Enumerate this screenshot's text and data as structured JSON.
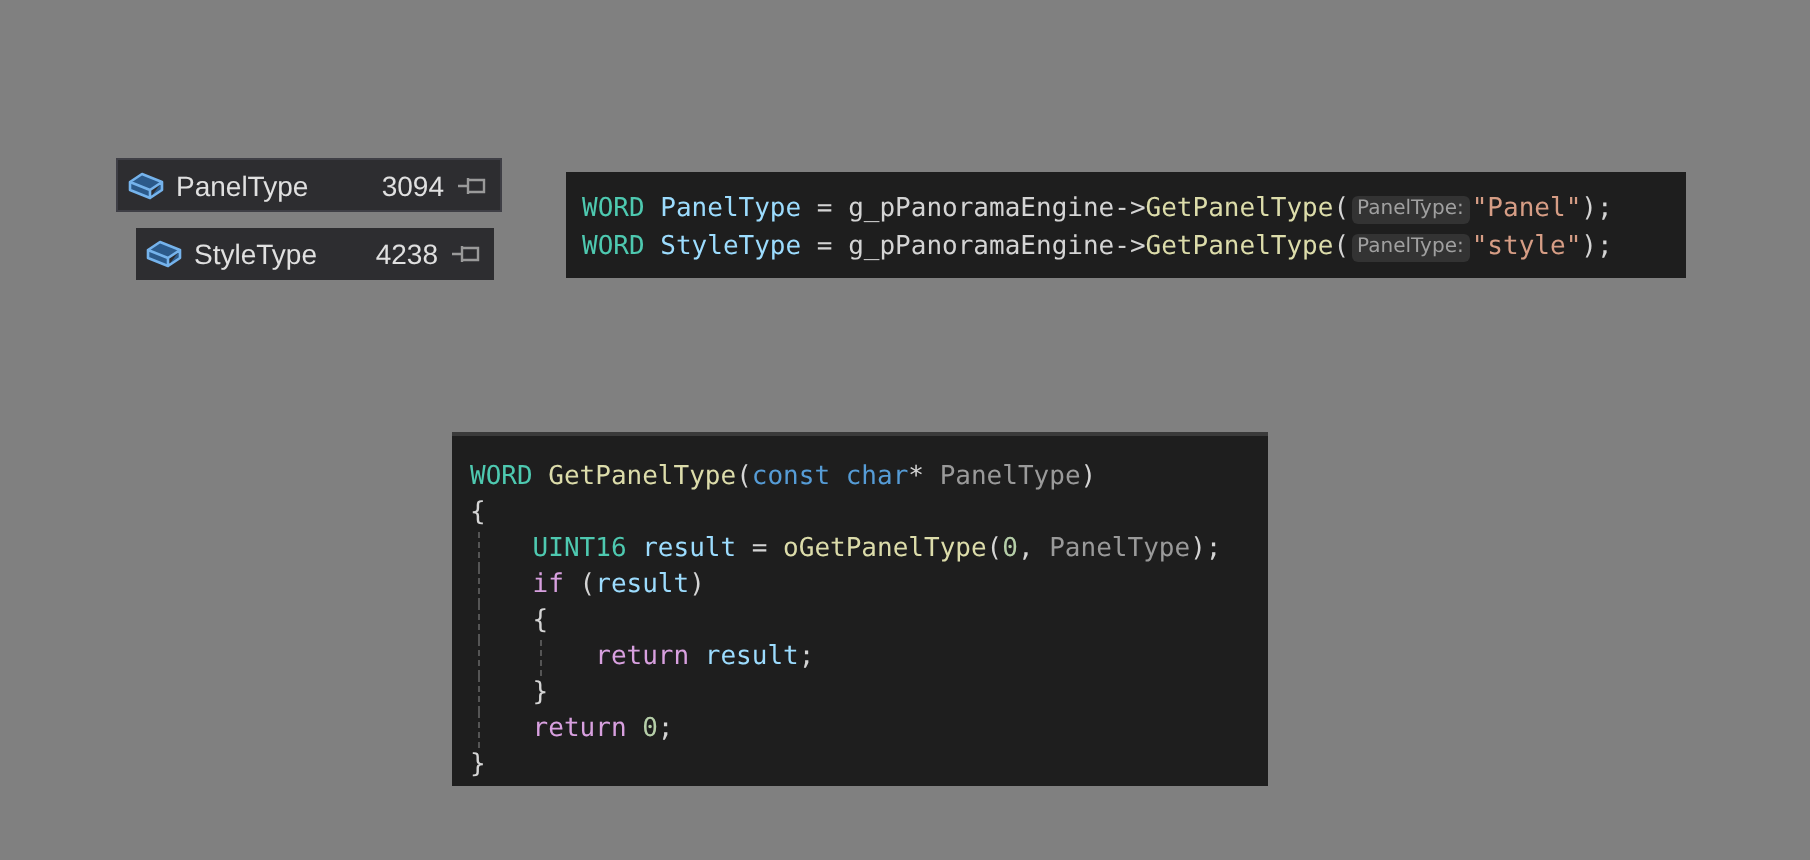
{
  "completion_items": [
    {
      "label": "PanelType",
      "count": "3094"
    },
    {
      "label": "StyleType",
      "count": "4238"
    }
  ],
  "call_snippet": {
    "lines": [
      [
        {
          "kind": "code",
          "tokens": [
            {
              "kind": "type",
              "text": "WORD "
            },
            {
              "kind": "var",
              "text": "PanelType"
            },
            {
              "kind": "plain",
              "text": " = g_pPanoramaEngine->"
            },
            {
              "kind": "func",
              "text": "GetPanelType"
            },
            {
              "kind": "plain",
              "text": "("
            }
          ]
        },
        {
          "kind": "hint",
          "text": "PanelType:"
        },
        {
          "kind": "code",
          "tokens": [
            {
              "kind": "string",
              "text": "\"Panel\""
            },
            {
              "kind": "plain",
              "text": ");"
            }
          ]
        }
      ],
      [
        {
          "kind": "code",
          "tokens": [
            {
              "kind": "type",
              "text": "WORD "
            },
            {
              "kind": "var",
              "text": "StyleType"
            },
            {
              "kind": "plain",
              "text": " = g_pPanoramaEngine->"
            },
            {
              "kind": "func",
              "text": "GetPanelType"
            },
            {
              "kind": "plain",
              "text": "("
            }
          ]
        },
        {
          "kind": "hint",
          "text": "PanelType:"
        },
        {
          "kind": "code",
          "tokens": [
            {
              "kind": "string",
              "text": "\"style\""
            },
            {
              "kind": "plain",
              "text": ");"
            }
          ]
        }
      ]
    ]
  },
  "function_snippet": {
    "lines": [
      [
        {
          "kind": "type",
          "text": "WORD "
        },
        {
          "kind": "func",
          "text": "GetPanelType"
        },
        {
          "kind": "plain",
          "text": "("
        },
        {
          "kind": "keyword",
          "text": "const char"
        },
        {
          "kind": "plain",
          "text": "* "
        },
        {
          "kind": "param",
          "text": "PanelType"
        },
        {
          "kind": "plain",
          "text": ")"
        }
      ],
      [
        {
          "kind": "plain",
          "text": "{"
        }
      ],
      [
        {
          "kind": "type",
          "text": "    UINT16 "
        },
        {
          "kind": "var",
          "text": "result"
        },
        {
          "kind": "plain",
          "text": " = "
        },
        {
          "kind": "func",
          "text": "oGetPanelType"
        },
        {
          "kind": "plain",
          "text": "("
        },
        {
          "kind": "number",
          "text": "0"
        },
        {
          "kind": "plain",
          "text": ", "
        },
        {
          "kind": "param",
          "text": "PanelType"
        },
        {
          "kind": "plain",
          "text": ");"
        }
      ],
      [
        {
          "kind": "control",
          "text": "    if "
        },
        {
          "kind": "plain",
          "text": "("
        },
        {
          "kind": "var",
          "text": "result"
        },
        {
          "kind": "plain",
          "text": ")"
        }
      ],
      [
        {
          "kind": "plain",
          "text": "    {"
        }
      ],
      [
        {
          "kind": "control",
          "text": "        return "
        },
        {
          "kind": "var",
          "text": "result"
        },
        {
          "kind": "plain",
          "text": ";"
        }
      ],
      [
        {
          "kind": "plain",
          "text": "    }"
        }
      ],
      [
        {
          "kind": "control",
          "text": "    return "
        },
        {
          "kind": "number",
          "text": "0"
        },
        {
          "kind": "plain",
          "text": ";"
        }
      ],
      [
        {
          "kind": "plain",
          "text": "}"
        }
      ]
    ]
  }
}
